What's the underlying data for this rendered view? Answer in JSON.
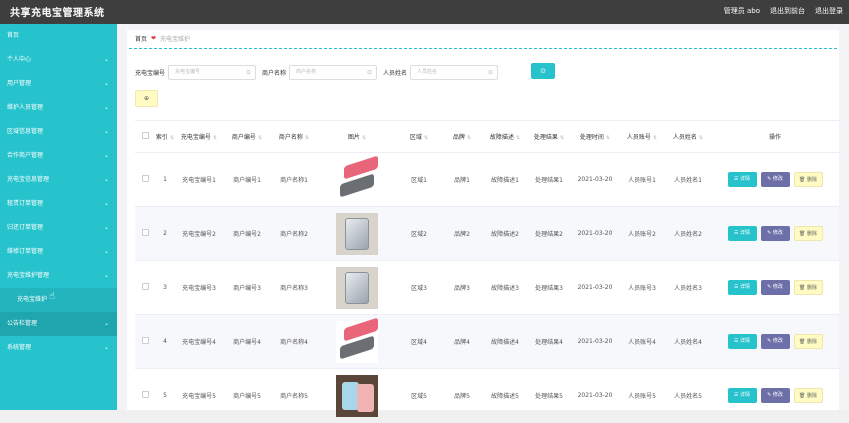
{
  "header": {
    "title": "共享充电宝管理系统",
    "admin": "管理员 abo",
    "exit_admin": "退出到前台",
    "logout": "退出登录"
  },
  "sidebar": {
    "items": [
      {
        "label": "首页",
        "chevron": false
      },
      {
        "label": "个人中心",
        "chevron": true
      },
      {
        "label": "用户管理",
        "chevron": true
      },
      {
        "label": "维护人员管理",
        "chevron": true
      },
      {
        "label": "区域信息管理",
        "chevron": true
      },
      {
        "label": "合作商户管理",
        "chevron": true
      },
      {
        "label": "充电宝信息管理",
        "chevron": true
      },
      {
        "label": "租赁订单管理",
        "chevron": true
      },
      {
        "label": "归还订单管理",
        "chevron": true
      },
      {
        "label": "维修订单管理",
        "chevron": true
      },
      {
        "label": "充电宝维护管理",
        "chevron": true
      },
      {
        "label": "充电宝维护",
        "chevron": false,
        "sub": true
      },
      {
        "label": "公告栏管理",
        "chevron": true,
        "active": true
      },
      {
        "label": "系统管理",
        "chevron": true
      }
    ]
  },
  "breadcrumb": {
    "home": "首页",
    "sep": "❤",
    "current": "充电宝维护"
  },
  "search": {
    "fields": [
      {
        "label": "充电宝编号",
        "placeholder": "充电宝编号"
      },
      {
        "label": "商户名称",
        "placeholder": "商户名称"
      },
      {
        "label": "人员姓名",
        "placeholder": "人员姓名"
      }
    ],
    "button_icon": "⊙"
  },
  "toolbar": {
    "add_label": "⊕"
  },
  "table": {
    "headers": [
      "索引",
      "充电宝编号",
      "商户编号",
      "商户名称",
      "图片",
      "区域",
      "品牌",
      "故障描述",
      "处理结果",
      "处理时间",
      "人员账号",
      "人员姓名",
      "操作"
    ],
    "rows": [
      {
        "index": "1",
        "code": "充电宝编号1",
        "mno": "商户编号1",
        "mname": "商户名称1",
        "area": "区域1",
        "brand": "品牌1",
        "fault": "故障描述1",
        "result": "处理结果1",
        "time": "2021-03-20",
        "acct": "人员账号1",
        "person": "人员姓名1",
        "img": "pink-gray"
      },
      {
        "index": "2",
        "code": "充电宝编号2",
        "mno": "商户编号2",
        "mname": "商户名称2",
        "area": "区域2",
        "brand": "品牌2",
        "fault": "故障描述2",
        "result": "处理结果2",
        "time": "2021-03-20",
        "acct": "人员账号2",
        "person": "人员姓名2",
        "img": "silver"
      },
      {
        "index": "3",
        "code": "充电宝编号3",
        "mno": "商户编号3",
        "mname": "商户名称3",
        "area": "区域3",
        "brand": "品牌3",
        "fault": "故障描述3",
        "result": "处理结果3",
        "time": "2021-03-20",
        "acct": "人员账号3",
        "person": "人员姓名3",
        "img": "silver"
      },
      {
        "index": "4",
        "code": "充电宝编号4",
        "mno": "商户编号4",
        "mname": "商户名称4",
        "area": "区域4",
        "brand": "品牌4",
        "fault": "故障描述4",
        "result": "处理结果4",
        "time": "2021-03-20",
        "acct": "人员账号4",
        "person": "人员姓名4",
        "img": "pink-gray"
      },
      {
        "index": "5",
        "code": "充电宝编号5",
        "mno": "商户编号5",
        "mname": "商户名称5",
        "area": "区域5",
        "brand": "品牌5",
        "fault": "故障描述5",
        "result": "处理结果5",
        "time": "2021-03-20",
        "acct": "人员账号5",
        "person": "人员姓名5",
        "img": "blue-pink"
      }
    ],
    "actions": {
      "detail": "☰ 详情",
      "edit": "✎ 修改",
      "delete": "🗑 删除"
    }
  },
  "colors": {
    "accent": "#27c3cc",
    "topbar": "#3e3e3e",
    "edit": "#6c6fa8",
    "delete": "#fffbc2"
  }
}
